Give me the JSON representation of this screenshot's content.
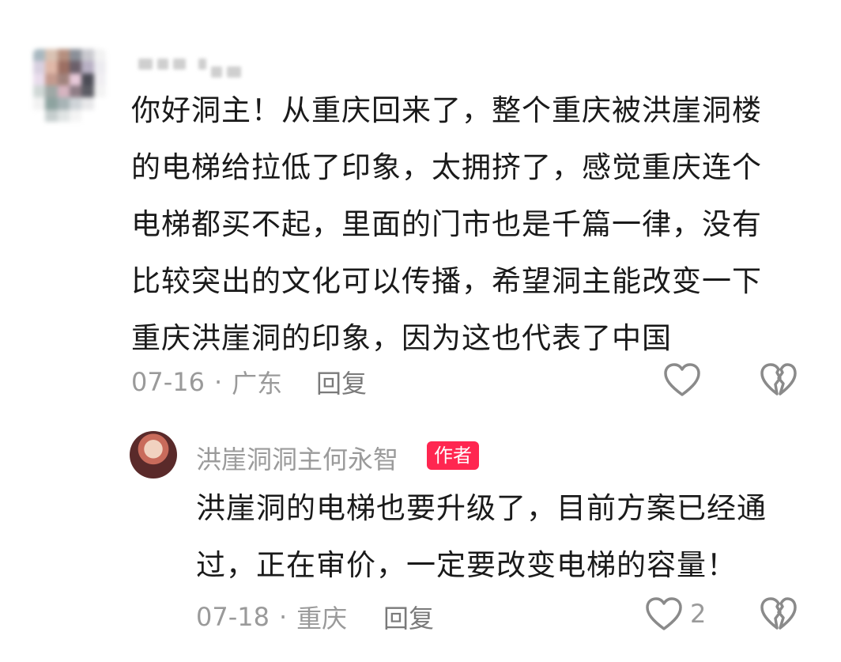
{
  "comment": {
    "lines": [
      "你好洞主！从重庆回来了，整个重庆被洪崖洞楼",
      "的电梯给拉低了印象，太拥挤了，感觉重庆连个",
      "电梯都买不起，里面的门市也是千篇一律，没有",
      "比较突出的文化可以传播，希望洞主能改变一下",
      "重庆洪崖洞的印象，因为这也代表了中国"
    ],
    "date": "07-16",
    "location": "广东",
    "reply_label": "回复"
  },
  "reply": {
    "author": "洪崖洞洞主何永智",
    "badge": "作者",
    "lines": [
      "洪崖洞的电梯也要升级了，目前方案已经通",
      "过，正在审价，一定要改变电梯的容量！"
    ],
    "date": "07-18",
    "location": "重庆",
    "reply_label": "回复",
    "like_count": "2"
  },
  "colors": {
    "text": "#1a1a1a",
    "meta": "#9a9a9a",
    "badge": "#ff2650"
  },
  "icons": [
    "heart-outline-icon",
    "broken-heart-icon"
  ]
}
